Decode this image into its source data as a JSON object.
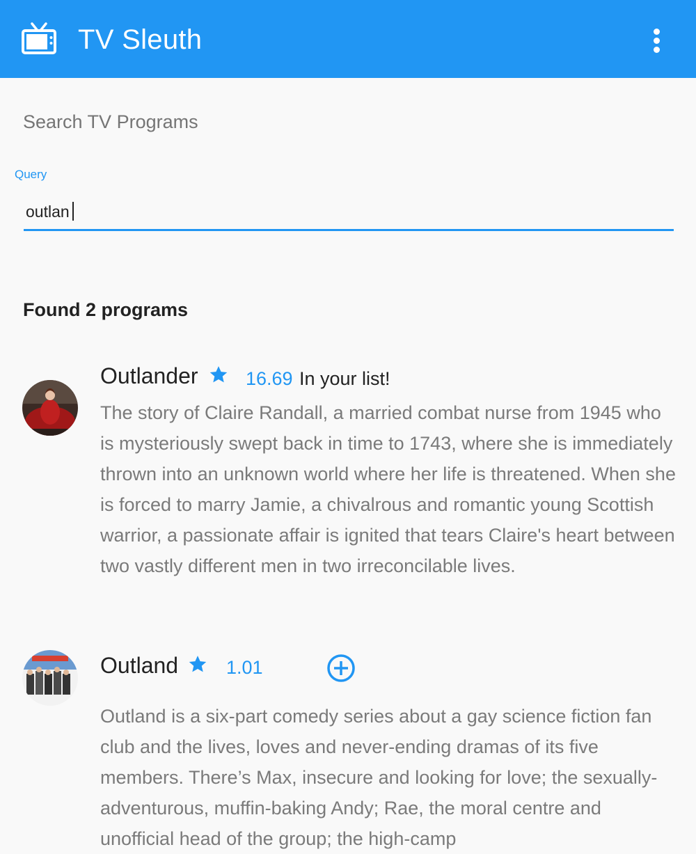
{
  "app": {
    "title": "TV Sleuth",
    "accent_color": "#2196f3",
    "logo_icon": "tv-icon",
    "menu_icon": "more-vert-icon"
  },
  "search": {
    "section_title": "Search TV Programs",
    "label": "Query",
    "value": "outlan"
  },
  "results": {
    "summary": "Found 2 programs",
    "items": [
      {
        "name": "Outlander",
        "rating_icon": "star-icon",
        "rating": "16.69",
        "status": "In your list!",
        "description": "The story of Claire Randall, a married combat nurse from 1945 who is mysteriously swept back in time to 1743, where she is immediately thrown into an unknown world where her life is threatened. When she is forced to marry Jamie, a chivalrous and romantic young Scottish warrior, a passionate affair is ignited that tears Claire's heart between two vastly different men in two irreconcilable lives."
      },
      {
        "name": "Outland",
        "rating_icon": "star-icon",
        "rating": "1.01",
        "action_icon": "add-circle-icon",
        "description": "Outland is a six-part comedy series about a gay science fiction fan club and the lives, loves and never-ending dramas of its five members. There’s Max, insecure and looking for love; the sexually-adventurous, muffin-baking Andy; Rae, the moral centre and unofficial head of the group; the high-camp"
      }
    ]
  }
}
